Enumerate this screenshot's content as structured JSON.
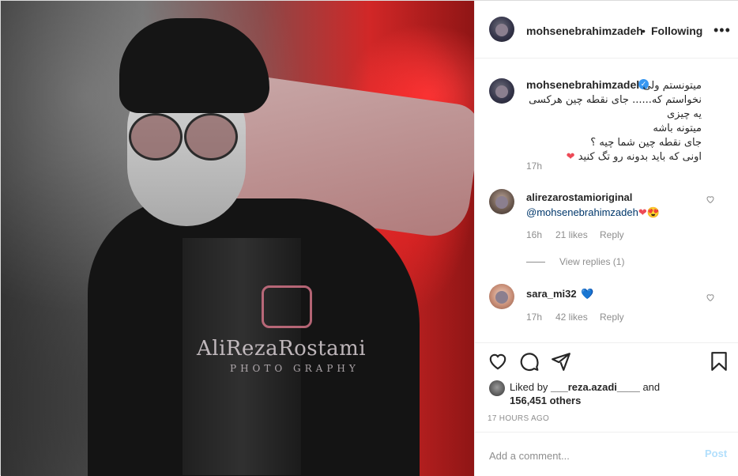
{
  "post": {
    "username": "mohsenebrahimzadeh",
    "separator": "•",
    "follow_status": "Following",
    "more_label": "•••"
  },
  "photo": {
    "watermark": "AliRezaRostami",
    "watermark_sub": "PHOTO GRAPHY"
  },
  "caption": {
    "username": "mohsenebrahimzadeh",
    "verified_icon": "verified-badge-icon",
    "lines": [
      "میتونستم ولی",
      "نخواستم که...... جای نقطه چین هرکسی یه چیزی",
      "میتونه باشه",
      "جای نقطه چین شما چیه ؟",
      "اونی که باید بدونه رو تگ کنید"
    ],
    "heart_emoji": "❤",
    "time": "17h"
  },
  "comments": [
    {
      "username": "alirezarostamioriginal",
      "text": "@mohsenebrahimzadeh",
      "emoji": "❤😍",
      "time": "16h",
      "likes": "21 likes",
      "reply_label": "Reply"
    },
    {
      "username": "sara_mi32",
      "emoji": "💙",
      "time": "17h",
      "likes": "42 likes",
      "reply_label": "Reply"
    }
  ],
  "view_replies": "View replies (1)",
  "likes": {
    "prefix": "Liked by",
    "user": "___reza.azadi____",
    "connector": "and",
    "count": "156,451 others"
  },
  "timestamp": "17 HOURS AGO",
  "add_comment": {
    "placeholder": "Add a comment...",
    "post_label": "Post"
  },
  "colors": {
    "link": "#00376b",
    "muted": "#8e8e8e",
    "verified": "#3897f0",
    "post_button": "#b2dffc",
    "heart": "#ed4956"
  }
}
